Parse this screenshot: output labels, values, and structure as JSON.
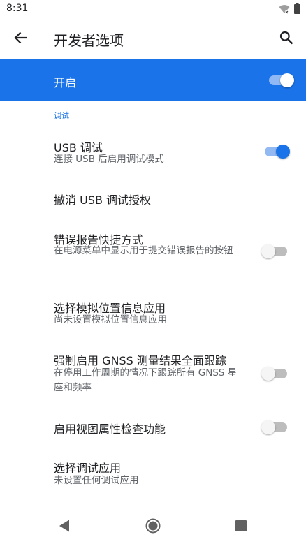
{
  "status_bar": {
    "time": "8:31"
  },
  "app_bar": {
    "title": "开发者选项"
  },
  "master_switch": {
    "label": "开启",
    "checked": true
  },
  "section": {
    "header": "调试"
  },
  "preferences": [
    {
      "title": "USB 调试",
      "summary": "连接 USB 后启用调试模式",
      "toggle": "on"
    },
    {
      "title": "撤消 USB 调试授权",
      "summary": "",
      "toggle": "none"
    },
    {
      "title": "错误报告快捷方式",
      "summary": "在电源菜单中显示用于提交错误报告的按钮",
      "toggle": "off"
    },
    {
      "title": "选择模拟位置信息应用",
      "summary": "尚未设置模拟位置信息应用",
      "toggle": "none"
    },
    {
      "title": "强制启用 GNSS 测量结果全面跟踪",
      "summary": "在停用工作周期的情况下跟踪所有 GNSS 星座和频率",
      "toggle": "off"
    },
    {
      "title": "启用视图属性检查功能",
      "summary": "",
      "toggle": "off"
    },
    {
      "title": "选择调试应用",
      "summary": "未设置任何调试应用",
      "toggle": "none"
    }
  ],
  "colors": {
    "accent": "#1a73e8",
    "text_primary": "#202124",
    "text_secondary": "#5f6368"
  },
  "icons": {
    "back": "arrow-back-icon",
    "search": "search-icon",
    "wifi": "wifi-icon",
    "battery": "battery-icon",
    "nav_back": "nav-back-icon",
    "nav_home": "nav-home-icon",
    "nav_recents": "nav-recents-icon"
  }
}
